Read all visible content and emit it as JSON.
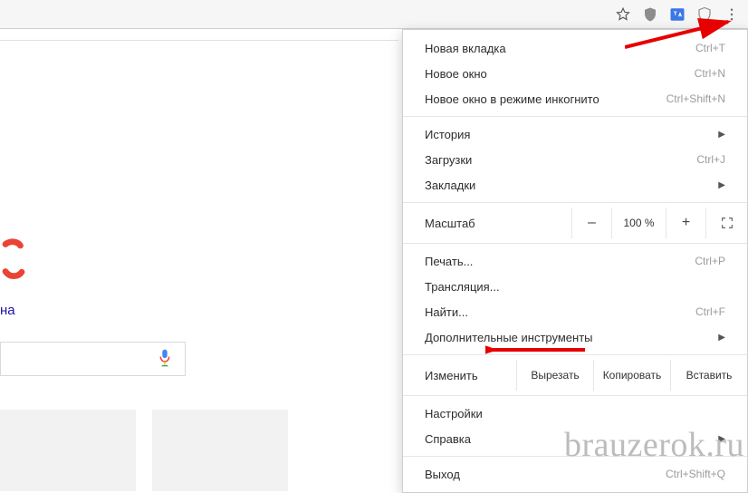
{
  "toolbar": {
    "icons": [
      "star-icon",
      "shield-grey-icon",
      "translate-icon",
      "shield-outline-icon",
      "menu-dots-icon"
    ]
  },
  "page": {
    "caption": "на",
    "tiles": [
      1,
      2
    ]
  },
  "menu": {
    "group1": [
      {
        "label": "Новая вкладка",
        "shortcut": "Ctrl+T"
      },
      {
        "label": "Новое окно",
        "shortcut": "Ctrl+N"
      },
      {
        "label": "Новое окно в режиме инкогнито",
        "shortcut": "Ctrl+Shift+N"
      }
    ],
    "group2": [
      {
        "label": "История",
        "sub": true
      },
      {
        "label": "Загрузки",
        "shortcut": "Ctrl+J"
      },
      {
        "label": "Закладки",
        "sub": true
      }
    ],
    "zoom": {
      "label": "Масштаб",
      "value": "100 %",
      "minus": "–",
      "plus": "+"
    },
    "group3": [
      {
        "label": "Печать...",
        "shortcut": "Ctrl+P"
      },
      {
        "label": "Трансляция..."
      },
      {
        "label": "Найти...",
        "shortcut": "Ctrl+F"
      },
      {
        "label": "Дополнительные инструменты",
        "sub": true
      }
    ],
    "edit": {
      "label": "Изменить",
      "cut": "Вырезать",
      "copy": "Копировать",
      "paste": "Вставить"
    },
    "group4": [
      {
        "label": "Настройки"
      },
      {
        "label": "Справка",
        "sub": true
      }
    ],
    "group5": [
      {
        "label": "Выход",
        "shortcut": "Ctrl+Shift+Q"
      }
    ]
  },
  "watermark": "brauzerok.ru"
}
